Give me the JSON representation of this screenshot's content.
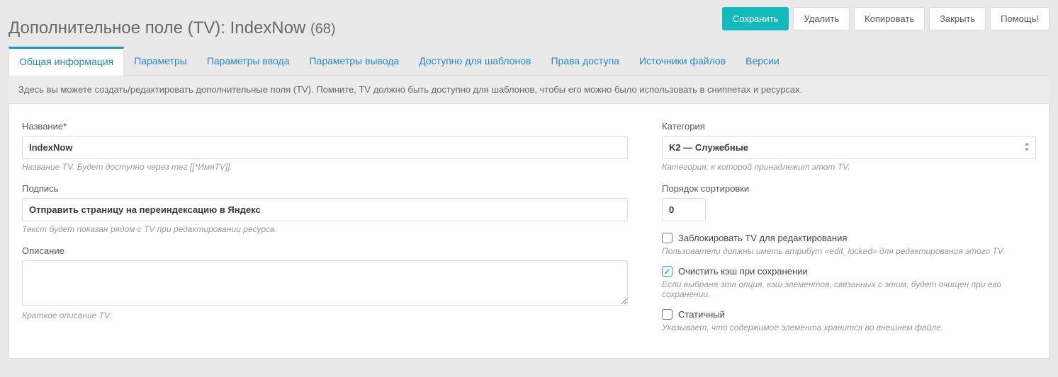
{
  "header": {
    "title_prefix": "Дополнительное поле (TV): ",
    "title_name": "IndexNow",
    "title_id": "(68)"
  },
  "toolbar": {
    "save": "Сохранить",
    "delete": "Удалить",
    "copy": "Копировать",
    "close": "Закрыть",
    "help": "Помощь!"
  },
  "tabs": [
    "Общая информация",
    "Параметры",
    "Параметры ввода",
    "Параметры вывода",
    "Доступно для шаблонов",
    "Права доступа",
    "Источники файлов",
    "Версии"
  ],
  "description_bar": "Здесь вы можете создать/редактировать дополнительные поля (TV). Помните, TV должно быть доступно для шаблонов, чтобы его можно было использовать в сниппетах и ресурсах.",
  "form": {
    "name_label": "Название*",
    "name_value": "IndexNow",
    "name_help": "Название TV. Будет доступно через тег [[*ИмяTV]].",
    "caption_label": "Подпись",
    "caption_value": "Отправить страницу на переиндексацию в Яндекс",
    "caption_help": "Текст будет показан рядом с TV при редактировании ресурса.",
    "desc_label": "Описание",
    "desc_value": "",
    "desc_help": "Краткое описание TV.",
    "category_label": "Категория",
    "category_value": "K2 — Служебные",
    "category_help": "Категория, к которой принадлежит этот TV.",
    "sort_label": "Порядок сортировки",
    "sort_value": "0",
    "lock_label": "Заблокировать TV для редактирования",
    "lock_help": "Пользователи должны иметь атрибут «edit_locked» для редактирования этого TV.",
    "clear_label": "Очистить кэш при сохранении",
    "clear_help": "Если выбрана эта опция, кэш элементов, связанных с этим, будет очищен при его сохранении.",
    "static_label": "Статичный",
    "static_help": "Указывает, что содержимое элемента хранится во внешнем файле."
  }
}
